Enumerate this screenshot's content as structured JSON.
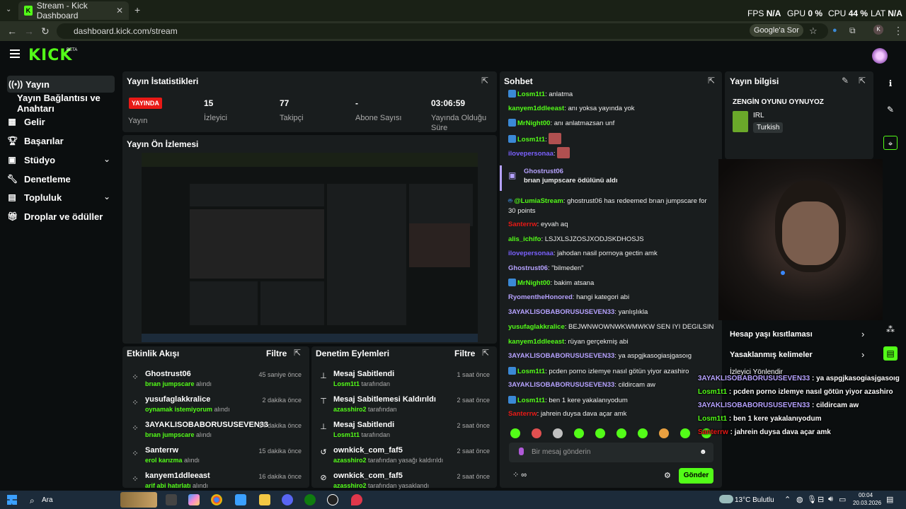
{
  "browser": {
    "tab_title": "Stream - Kick Dashboard",
    "url": "dashboard.kick.com/stream",
    "google_button": "Google'a Sor",
    "profile_initial": "K",
    "hud": {
      "fps_label": "FPS",
      "fps": "N/A",
      "gpu_label": "GPU",
      "gpu": "0 %",
      "cpu_label": "CPU",
      "cpu": "44 %",
      "lat_label": "LAT",
      "lat": "N/A"
    }
  },
  "header": {
    "logo": "KICK",
    "beta": "BETA"
  },
  "sidebar": {
    "items": [
      {
        "label": "Yayın",
        "icon": "broadcast-icon"
      },
      {
        "label": "Yayın Bağlantısı ve Anahtarı"
      },
      {
        "label": "Gelir",
        "icon": "revenue-icon"
      },
      {
        "label": "Başarılar",
        "icon": "trophy-icon"
      },
      {
        "label": "Stüdyo",
        "icon": "studio-icon"
      },
      {
        "label": "Denetleme",
        "icon": "wrench-icon"
      },
      {
        "label": "Topluluk",
        "icon": "community-icon"
      },
      {
        "label": "Droplar ve ödüller",
        "icon": "gift-icon"
      }
    ]
  },
  "stats": {
    "title": "Yayın İstatistikleri",
    "live_badge": "YAYINDA",
    "live_label": "Yayın",
    "viewers": {
      "value": "15",
      "label": "İzleyici"
    },
    "followers": {
      "value": "77",
      "label": "Takipçi"
    },
    "subs": {
      "value": "-",
      "label": "Abone Sayısı"
    },
    "uptime": {
      "value": "03:06:59",
      "label": "Yayında Olduğu Süre"
    }
  },
  "preview": {
    "title": "Yayın Ön İzlemesi"
  },
  "activity": {
    "title": "Etkinlik Akışı",
    "filter": "Filtre",
    "items": [
      {
        "name": "Ghostrust06",
        "sub": "brıan jumpscare",
        "suffix": "alındı",
        "time": "45 saniye önce"
      },
      {
        "name": "yusufaglakkralice",
        "sub": "oynamak istemiyorum",
        "suffix": "alındı",
        "time": "2 dakika önce"
      },
      {
        "name": "3AYAKLISOBABORUSUSEVEN33",
        "sub": "brıan jumpscare",
        "suffix": "alındı",
        "time": "14 dakika önce"
      },
      {
        "name": "Santerrw",
        "sub": "erol karızma",
        "suffix": "alındı",
        "time": "15 dakika önce"
      },
      {
        "name": "kanyem1ddleeast",
        "sub": "arif abi hatırlatı",
        "suffix": "alındı",
        "time": "16 dakika önce"
      }
    ]
  },
  "moderation": {
    "title": "Denetim Eylemleri",
    "filter": "Filtre",
    "items": [
      {
        "name": "Mesaj Sabitlendi",
        "sub": "Losm1t1",
        "suffix": "tarafından",
        "time": "1 saat önce",
        "icon": "pin-icon"
      },
      {
        "name": "Mesaj Sabitlemesi Kaldırıldı",
        "sub": "azasshiro2",
        "suffix": "tarafından",
        "time": "2 saat önce",
        "icon": "unpin-icon"
      },
      {
        "name": "Mesaj Sabitlendi",
        "sub": "Losm1t1",
        "suffix": "tarafından",
        "time": "2 saat önce",
        "icon": "pin-icon"
      },
      {
        "name": "ownkick_com_faf5",
        "sub": "azasshiro2",
        "suffix": "tarafından yasağı kaldırıldı",
        "time": "2 saat önce",
        "icon": "unban-icon"
      },
      {
        "name": "ownkick_com_faf5",
        "sub": "azasshiro2",
        "suffix": "tarafından yasaklandı",
        "time": "2 saat önce",
        "icon": "ban-icon"
      }
    ]
  },
  "chat": {
    "title": "Sohbet",
    "placeholder": "Bir mesaj gönderin",
    "send": "Gönder",
    "messages": [
      {
        "user": "Losm1t1",
        "color": "#53fc18",
        "badge": true,
        "text": "anlatma"
      },
      {
        "user": "kanyem1ddleeast",
        "color": "#53fc18",
        "text": "anı yoksa yayında yok"
      },
      {
        "user": "MrNight00",
        "color": "#53fc18",
        "badge": true,
        "text": "anı anlatmazsan unf"
      },
      {
        "user": "Losm1t1",
        "color": "#53fc18",
        "badge": true,
        "text": "",
        "emote": true
      },
      {
        "user": "ilovepersonaa",
        "color": "#7b61ff",
        "text": "",
        "emote": true
      },
      {
        "user": "Ghostrust06",
        "color": "#b6a2ff",
        "text": "brıan jumpscare ödülünü aldı",
        "reward": true
      },
      {
        "user": "@LumiaStream",
        "color": "#53fc18",
        "text": "ghostrust06 has redeemed brıan jumpscare for 30 points"
      },
      {
        "user": "Santerrw",
        "color": "#e91916",
        "text": "eyvah aq"
      },
      {
        "user": "alis_ichifo",
        "color": "#53fc18",
        "text": "LSJXLSJZOSJXODJSKDHOSJS"
      },
      {
        "user": "ilovepersonaa",
        "color": "#7b61ff",
        "text": "jahodan nasil pornoya gectin amk"
      },
      {
        "user": "Ghostrust06",
        "color": "#b6a2ff",
        "text": "\"bilmeden\""
      },
      {
        "user": "MrNight00",
        "color": "#53fc18",
        "badge": true,
        "text": "bakim atsana"
      },
      {
        "user": "RyomentheHonored",
        "color": "#b6a2ff",
        "text": "hangi kategori abi"
      },
      {
        "user": "3AYAKLISOBABORUSUSEVEN33",
        "color": "#b6a2ff",
        "text": "yanlışlıkla"
      },
      {
        "user": "yusufaglakkralice",
        "color": "#53fc18",
        "text": "BEJWNWOWNWKWMWKW SEN IYI DEGILSIN"
      },
      {
        "user": "kanyem1ddleeast",
        "color": "#53fc18",
        "text": "rüyan gerçekmiş abi"
      },
      {
        "user": "3AYAKLISOBABORUSUSEVEN33",
        "color": "#b6a2ff",
        "text": "ya aspgjkasogiasjgasoıg"
      },
      {
        "user": "Losm1t1",
        "color": "#53fc18",
        "badge": true,
        "text": "pcden porno izlemye nasıl götün yiyor azashiro"
      },
      {
        "user": "3AYAKLISOBABORUSUSEVEN33",
        "color": "#b6a2ff",
        "text": "cildircam aw"
      },
      {
        "user": "Losm1t1",
        "color": "#53fc18",
        "badge": true,
        "text": "ben 1 kere yakalanıyodum"
      },
      {
        "user": "Santerrw",
        "color": "#e91916",
        "text": "jahrein duysa dava açar amk"
      }
    ]
  },
  "info": {
    "title": "Yayın bilgisi",
    "stream_title": "ZENGİN OYUNU OYNUYOZ",
    "category": "IRL",
    "language": "Turkish"
  },
  "menu": [
    {
      "label": "Hesap yaşı kısıtlaması"
    },
    {
      "label": "Yasaklanmış kelimeler"
    },
    {
      "label": "İzleyici Yönlendir"
    }
  ],
  "overlay": [
    {
      "user": "3AYAKLISOBABORUSUSEVEN33",
      "text": " : ya aspgjkasogiasjgasoıg",
      "cls": "ov-u"
    },
    {
      "user": "Losm1t1",
      "text": " : pcden porno izlemye nasıl götün yiyor azashiro",
      "cls": "ov-g"
    },
    {
      "user": "3AYAKLISOBABORUSUSEVEN33",
      "text": " : cildircam aw",
      "cls": "ov-u"
    },
    {
      "user": "Losm1t1",
      "text": " : ben 1 kere yakalanıyodum",
      "cls": "ov-g"
    },
    {
      "user": "Santerrw",
      "text": " : jahrein duysa dava açar amk",
      "cls": "ov-r"
    }
  ],
  "taskbar": {
    "search": "Ara",
    "weather": "13°C Bulutlu",
    "time": "00:04",
    "date": "20.03.2026"
  },
  "colors": {
    "accent": "#53fc18",
    "live": "#e91916",
    "panel": "#191d1e"
  }
}
